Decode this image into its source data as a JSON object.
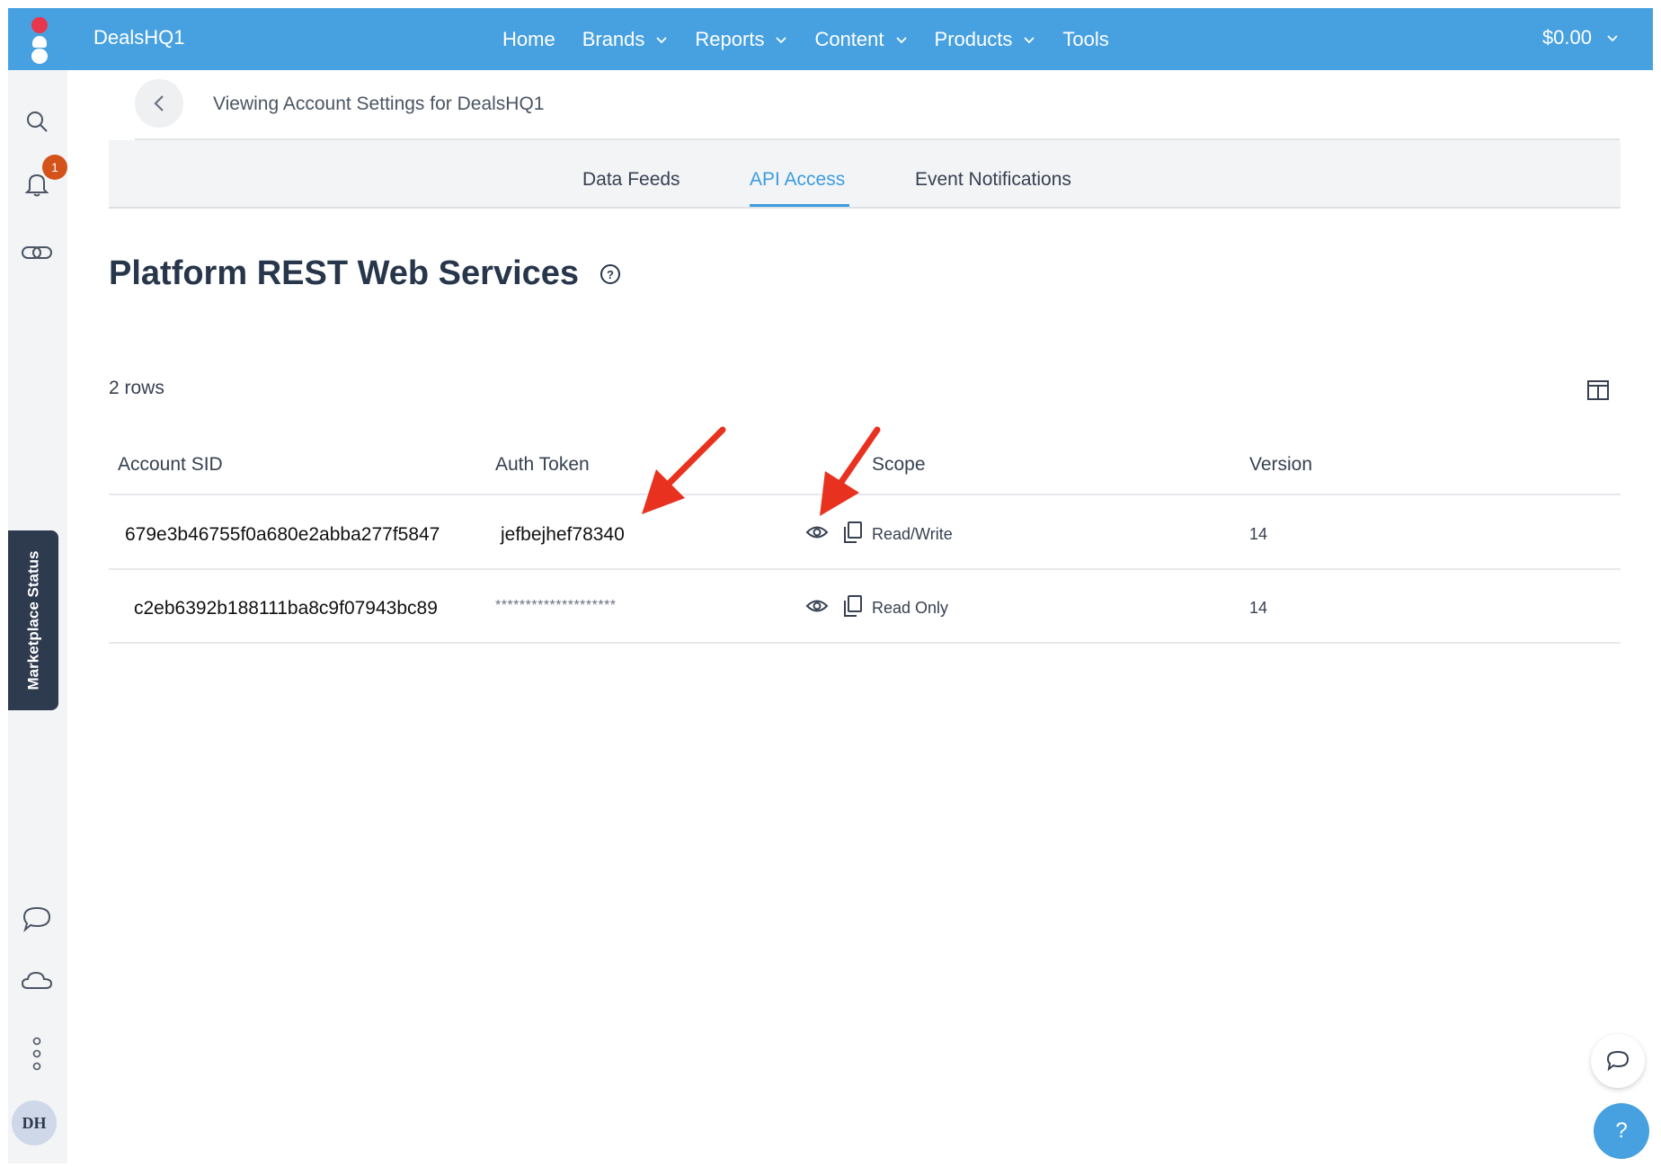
{
  "header": {
    "account_name": "DealsHQ1",
    "nav": [
      {
        "label": "Home"
      },
      {
        "label": "Brands"
      },
      {
        "label": "Reports"
      },
      {
        "label": "Content"
      },
      {
        "label": "Products"
      },
      {
        "label": "Tools"
      }
    ],
    "balance": "$0.00"
  },
  "sidebar": {
    "notification_count": "1",
    "marketplace_status": "Marketplace Status",
    "avatar_initials": "DH"
  },
  "breadcrumb": {
    "text": "Viewing Account Settings for DealsHQ1"
  },
  "tabs": [
    {
      "label": "Data Feeds",
      "active": false
    },
    {
      "label": "API Access",
      "active": true
    },
    {
      "label": "Event Notifications",
      "active": false
    }
  ],
  "main": {
    "title": "Platform REST Web Services",
    "help": "?",
    "rows_count": "2 rows"
  },
  "table": {
    "headers": [
      "Account SID",
      "Auth Token",
      "Scope",
      "Version"
    ],
    "rows": [
      {
        "sid": "679e3b46755f0a680e2abba277f5847",
        "token": "jefbejhef78340",
        "scope": "Read/Write",
        "version": "14"
      },
      {
        "sid": "c2eb6392b188111ba8c9f07943bc89",
        "token": "********************",
        "scope": "Read Only",
        "version": "14"
      }
    ]
  },
  "fab": {
    "help": "?"
  },
  "colors": {
    "brand_blue": "#47a1e0",
    "accent_blue": "#3d9ce0",
    "rail_dark": "#2e3a4e",
    "badge_orange": "#d4531b",
    "annotation_red": "#e8321f"
  }
}
